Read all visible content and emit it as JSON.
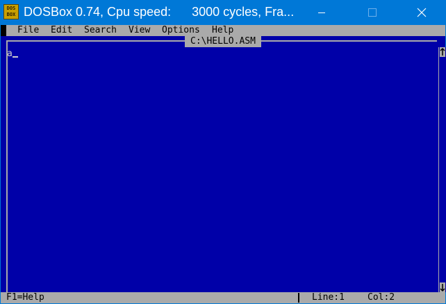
{
  "window": {
    "title": "DOSBox 0.74, Cpu speed:      3000 cycles, Fra...",
    "icon_text_top": "DOS",
    "icon_text_bottom": "BOX",
    "controls": [
      "minimize-icon",
      "maximize-icon",
      "close-icon"
    ],
    "colors": {
      "titlebar": "#0078d7",
      "screen": "#0000a8",
      "bars": "#aaaaaa"
    }
  },
  "menu": {
    "items": [
      {
        "label": "File"
      },
      {
        "label": "Edit"
      },
      {
        "label": "Search"
      },
      {
        "label": "View"
      },
      {
        "label": "Options"
      },
      {
        "label": "Help"
      }
    ]
  },
  "editor": {
    "file_title": "C:\\HELLO.ASM",
    "content": "a",
    "scroll_up_icon": "arrow-up-icon",
    "scroll_down_icon": "arrow-down-icon"
  },
  "status": {
    "help": "F1=Help",
    "line": "Line:1",
    "col": "Col:2"
  }
}
